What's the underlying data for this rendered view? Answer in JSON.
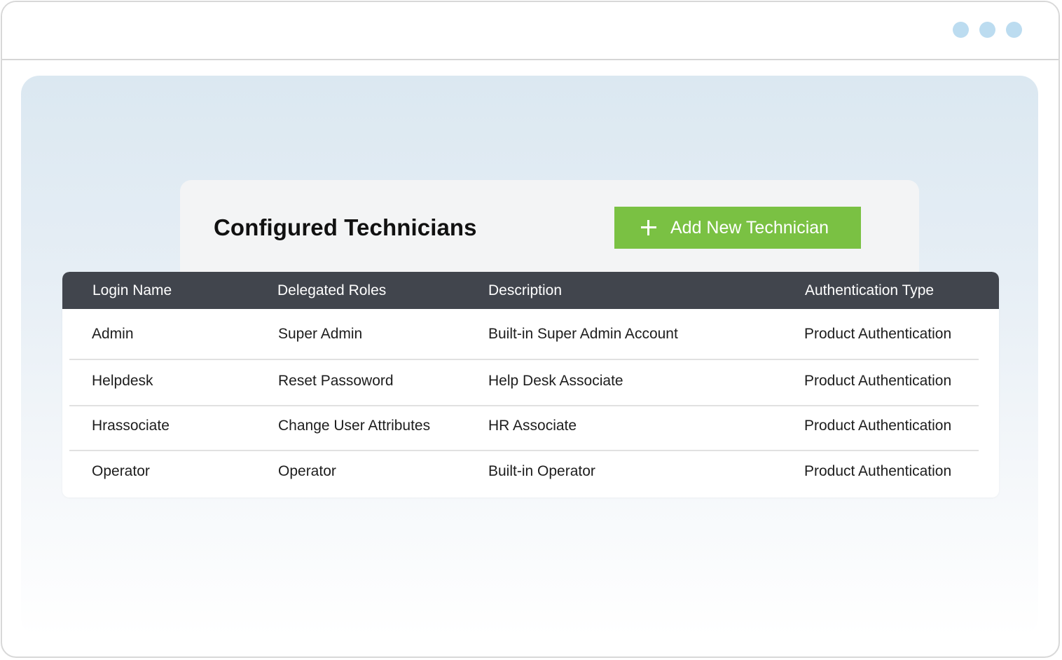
{
  "window": {
    "controls": [
      "dot-1",
      "dot-2",
      "dot-3"
    ],
    "control_color": "#bcdcf0"
  },
  "page": {
    "title": "Configured Technicians",
    "add_button_label": "Add New Technician",
    "add_button_icon": "plus-icon",
    "accent_color": "#7ac143",
    "header_color": "#41454d"
  },
  "table": {
    "columns": [
      "Login Name",
      "Delegated Roles",
      "Description",
      "Authentication Type"
    ],
    "rows": [
      [
        "Admin",
        "Super Admin",
        "Built-in Super Admin Account",
        "Product Authentication"
      ],
      [
        "Helpdesk",
        "Reset Passoword",
        "Help Desk Associate",
        "Product Authentication"
      ],
      [
        "Hrassociate",
        "Change User Attributes",
        "HR Associate",
        "Product Authentication"
      ],
      [
        "Operator",
        "Operator",
        "Built-in Operator",
        "Product Authentication"
      ]
    ]
  }
}
